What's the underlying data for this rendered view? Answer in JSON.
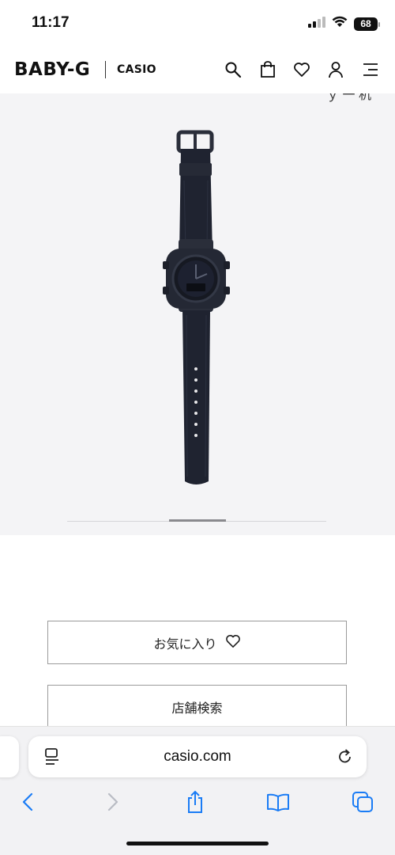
{
  "status_bar": {
    "time": "11:17",
    "battery": "68",
    "icons": [
      "cellular-signal-icon",
      "wifi-icon",
      "battery-icon"
    ]
  },
  "header": {
    "brand": "BABY-G",
    "sub_brand": "CASIO",
    "icons": [
      "search-icon",
      "shopping-bag-icon",
      "heart-icon",
      "user-icon",
      "menu-icon"
    ]
  },
  "product": {
    "image_alt": "black watch product image",
    "cutoff_text": "ｙ 一 机"
  },
  "buttons": {
    "favorite_label": "お気に入り",
    "store_search_label": "店舗検索"
  },
  "browser": {
    "address": "casio.com",
    "toolbar": [
      "back-icon",
      "forward-icon",
      "share-icon",
      "bookmarks-icon",
      "tabs-icon"
    ]
  },
  "colors": {
    "product_background": "#f4f4f6",
    "accent_blue": "#1a7cf5",
    "watch_body": "#1f2330"
  }
}
